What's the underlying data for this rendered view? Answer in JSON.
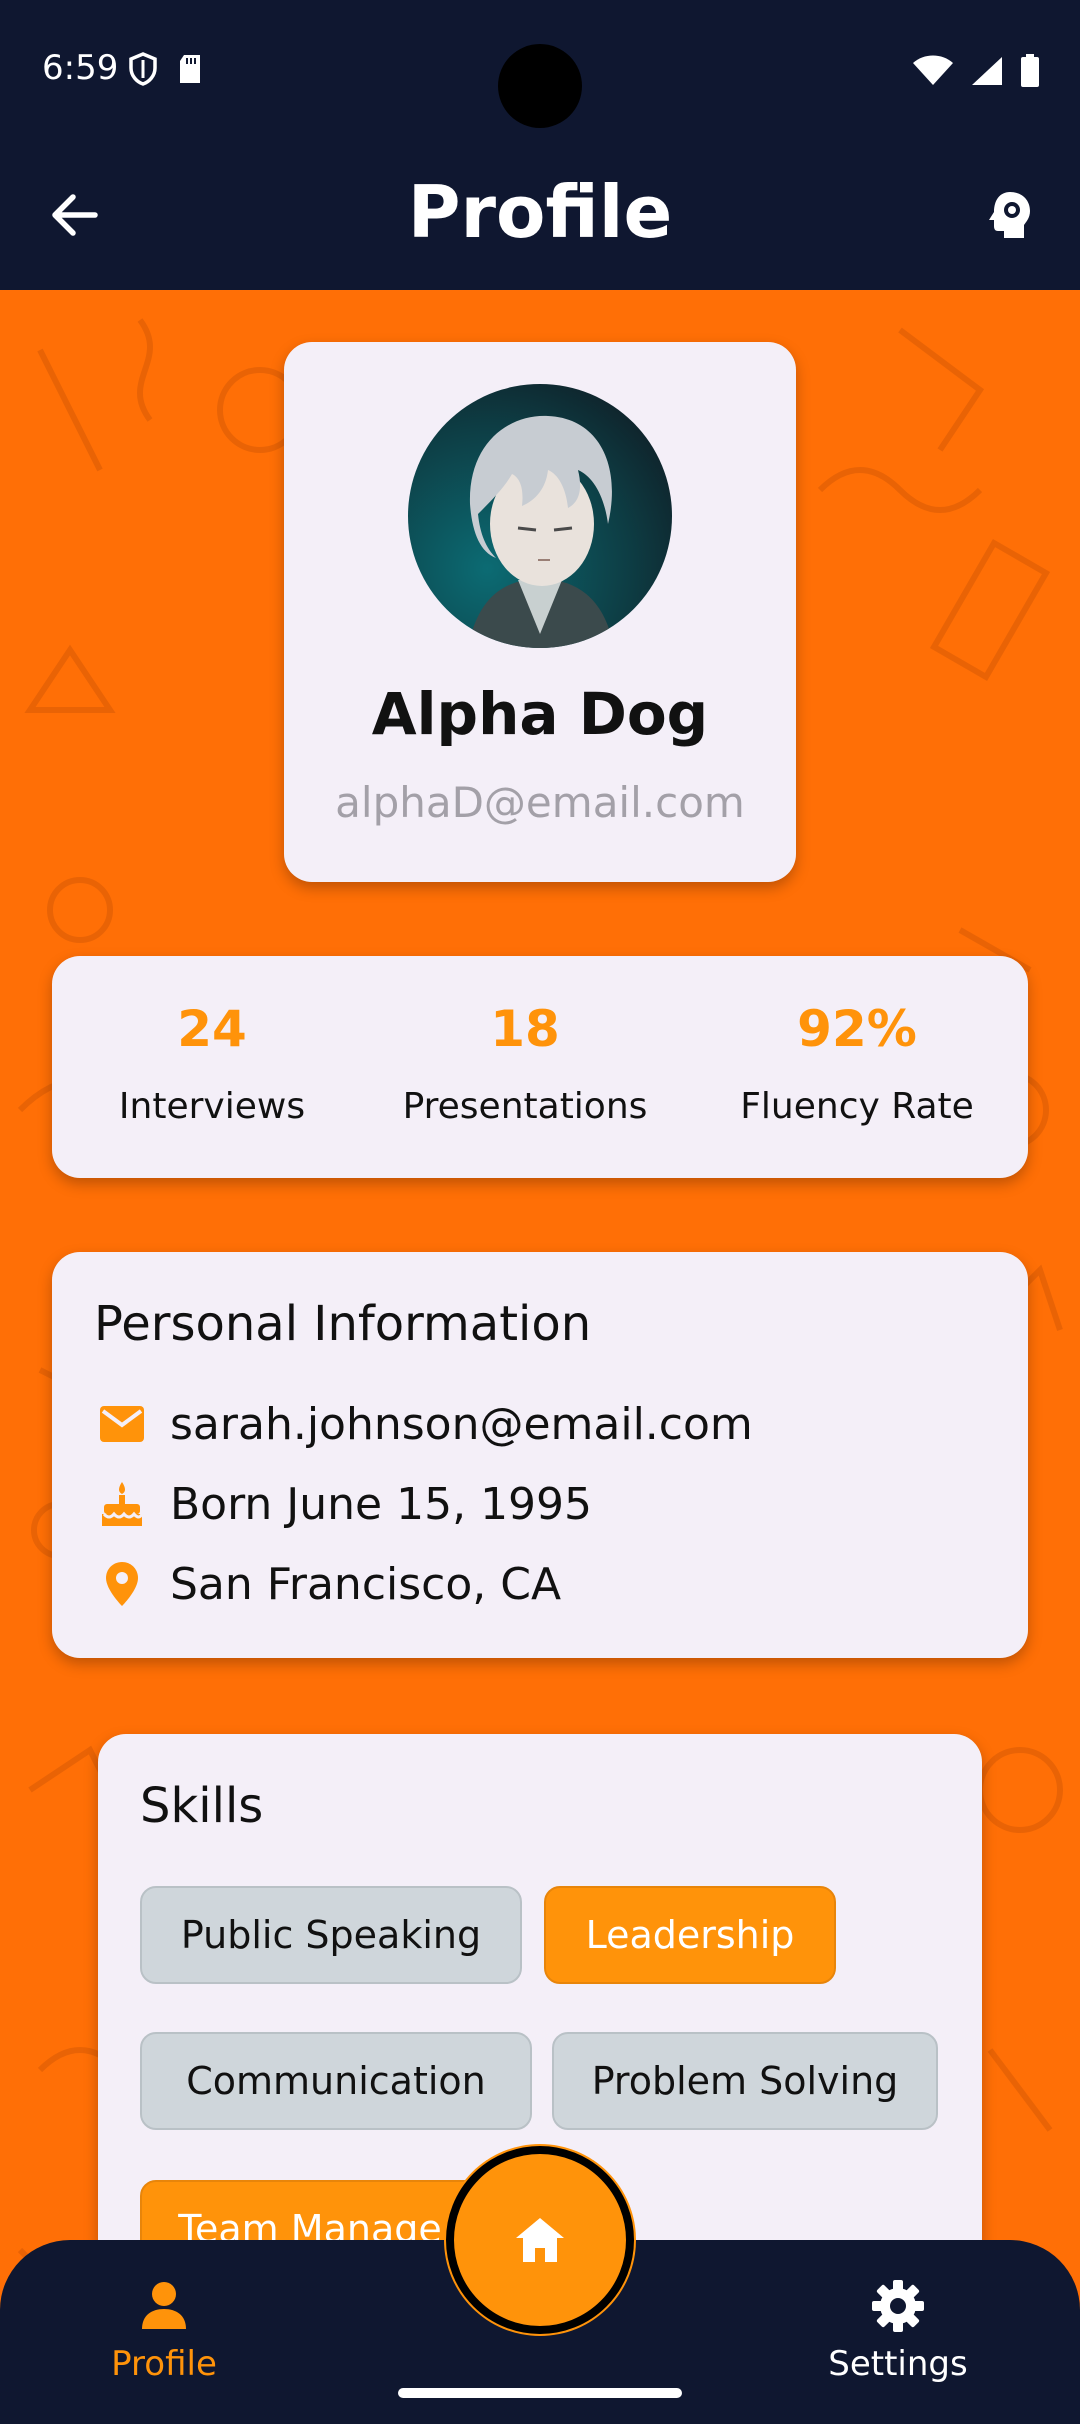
{
  "status_bar": {
    "time": "6:59"
  },
  "app_bar": {
    "title": "Profile"
  },
  "profile": {
    "name": "Alpha Dog",
    "email": "alphaD@email.com"
  },
  "stats": [
    {
      "value": "24",
      "label": "Interviews"
    },
    {
      "value": "18",
      "label": "Presentations"
    },
    {
      "value": "92%",
      "label": "Fluency Rate"
    }
  ],
  "personal_info": {
    "title": "Personal Information",
    "email": "sarah.johnson@email.com",
    "birthday": "Born June 15, 1995",
    "location": "San Francisco, CA"
  },
  "skills": {
    "title": "Skills",
    "items": [
      {
        "label": "Public Speaking",
        "highlighted": false
      },
      {
        "label": "Leadership",
        "highlighted": true
      },
      {
        "label": "Communication",
        "highlighted": false
      },
      {
        "label": "Problem Solving",
        "highlighted": false
      },
      {
        "label": "Team Manage",
        "highlighted": true
      }
    ]
  },
  "bottom_nav": {
    "profile_label": "Profile",
    "settings_label": "Settings",
    "active": "profile"
  },
  "colors": {
    "background": "#ff6f06",
    "dark": "#0f1730",
    "accent": "#ff930a",
    "card": "#f4eff8"
  }
}
